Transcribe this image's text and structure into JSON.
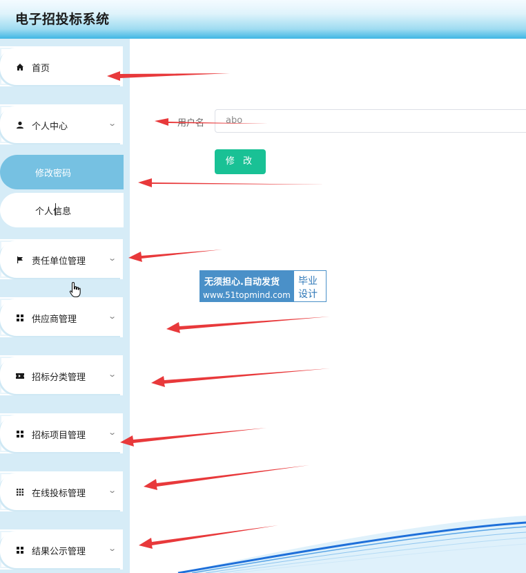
{
  "header": {
    "title": "电子招投标系统"
  },
  "sidebar": {
    "items": [
      {
        "label": "首页",
        "icon": "home-icon"
      },
      {
        "label": "个人中心",
        "icon": "user-icon"
      },
      {
        "label": "责任单位管理",
        "icon": "flag-icon"
      },
      {
        "label": "供应商管理",
        "icon": "grid-icon"
      },
      {
        "label": "招标分类管理",
        "icon": "ticket-icon"
      },
      {
        "label": "招标项目管理",
        "icon": "grid-icon"
      },
      {
        "label": "在线投标管理",
        "icon": "apps-icon"
      },
      {
        "label": "结果公示管理",
        "icon": "grid-icon"
      }
    ],
    "sub_items": {
      "active": "修改密码",
      "other": "个人信息"
    }
  },
  "form": {
    "username_label": "用户名",
    "username_value": "abo",
    "submit_label": "修 改"
  },
  "watermark": {
    "line1": "无须担心.自动发货",
    "line2": "www.51topmind.com",
    "side_top": "毕业",
    "side_bottom": "设计"
  },
  "colors": {
    "accent": "#19c195",
    "active_item": "#76c1e2",
    "annotation_arrow": "#e8393b"
  }
}
